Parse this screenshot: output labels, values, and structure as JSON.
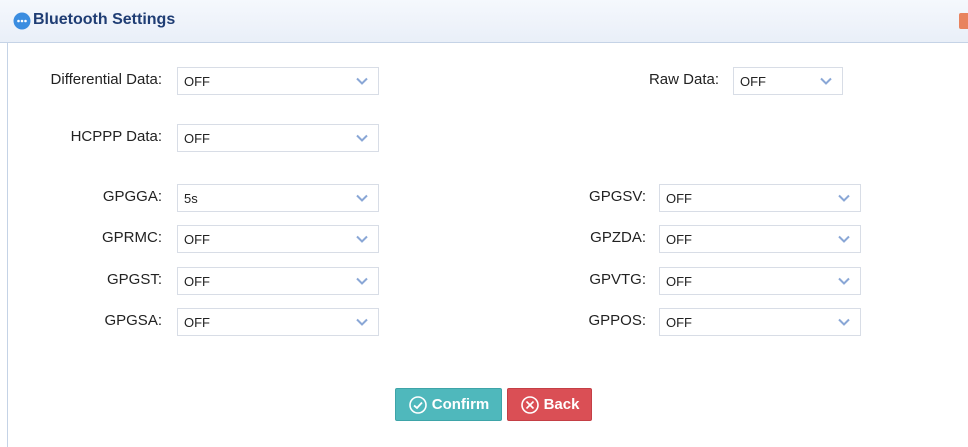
{
  "dialog": {
    "title": "Bluetooth Settings"
  },
  "fields": {
    "differential": {
      "label": "Differential Data:",
      "value": "OFF"
    },
    "raw": {
      "label": "Raw Data:",
      "value": "OFF"
    },
    "hcppp": {
      "label": "HCPPP Data:",
      "value": "OFF"
    },
    "gpgga": {
      "label": "GPGGA:",
      "value": "5s"
    },
    "gpgsv": {
      "label": "GPGSV:",
      "value": "OFF"
    },
    "gprmc": {
      "label": "GPRMC:",
      "value": "OFF"
    },
    "gpzda": {
      "label": "GPZDA:",
      "value": "OFF"
    },
    "gpgst": {
      "label": "GPGST:",
      "value": "OFF"
    },
    "gpvtg": {
      "label": "GPVTG:",
      "value": "OFF"
    },
    "gpgsa": {
      "label": "GPGSA:",
      "value": "OFF"
    },
    "gppos": {
      "label": "GPPOS:",
      "value": "OFF"
    }
  },
  "buttons": {
    "confirm": "Confirm",
    "back": "Back"
  }
}
